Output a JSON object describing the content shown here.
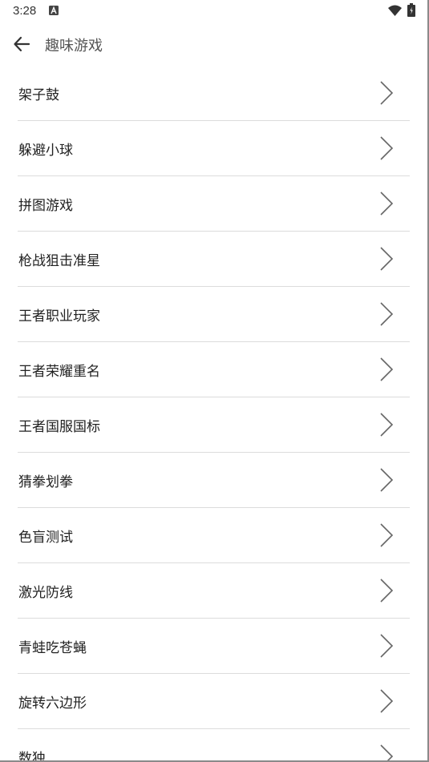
{
  "status_bar": {
    "time": "3:28",
    "icons": [
      "notification-a-icon",
      "wifi-icon",
      "battery-icon"
    ]
  },
  "header": {
    "back_icon": "arrow-left-icon",
    "title": "趣味游戏"
  },
  "games": [
    {
      "label": "架子鼓"
    },
    {
      "label": "躲避小球"
    },
    {
      "label": "拼图游戏"
    },
    {
      "label": "枪战狙击准星"
    },
    {
      "label": "王者职业玩家"
    },
    {
      "label": "王者荣耀重名"
    },
    {
      "label": "王者国服国标"
    },
    {
      "label": "猜拳划拳"
    },
    {
      "label": "色盲测试"
    },
    {
      "label": "激光防线"
    },
    {
      "label": "青蛙吃苍蝇"
    },
    {
      "label": "旋转六边形"
    },
    {
      "label": "数独"
    }
  ],
  "colors": {
    "divider": "#dcdcdc",
    "chevron": "#666666",
    "title": "#555555"
  }
}
